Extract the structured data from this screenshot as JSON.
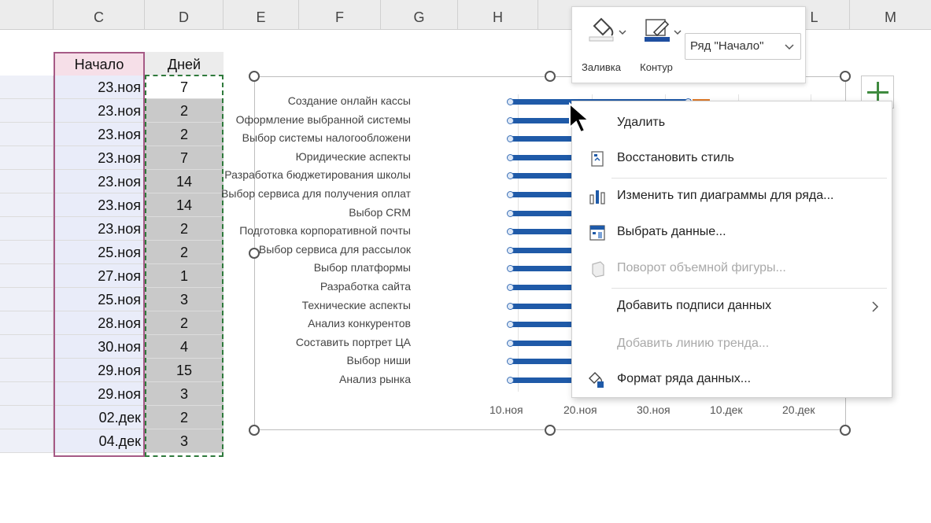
{
  "columns": [
    "C",
    "D",
    "E",
    "F",
    "G",
    "H",
    "L",
    "M"
  ],
  "table": {
    "header_start": "Начало",
    "header_days": "Дней",
    "start": [
      "23.ноя",
      "23.ноя",
      "23.ноя",
      "23.ноя",
      "23.ноя",
      "23.ноя",
      "23.ноя",
      "25.ноя",
      "27.ноя",
      "25.ноя",
      "28.ноя",
      "30.ноя",
      "29.ноя",
      "29.ноя",
      "02.дек",
      "04.дек"
    ],
    "days": [
      "7",
      "2",
      "2",
      "7",
      "14",
      "14",
      "2",
      "2",
      "1",
      "3",
      "2",
      "4",
      "15",
      "3",
      "2",
      "3"
    ]
  },
  "chart_data": {
    "type": "bar",
    "orientation": "horizontal",
    "categories": [
      "Создание онлайн кассы",
      "Оформление выбранной системы",
      "Выбор системы налогообложени",
      "Юридические аспекты",
      "Разработка бюджетирования школы",
      "Выбор сервиса для получения оплат",
      "Выбор CRM",
      "Подготовка корпоративной почты",
      "Выбор сервиса для рассылок",
      "Выбор платформы",
      "Разработка сайта",
      "Технические аспекты",
      "Анализ конкурентов",
      "Составить портрет ЦА",
      "Выбор ниши",
      "Анализ рынка"
    ],
    "x_ticks": [
      "10.ноя",
      "20.ноя",
      "30.ноя",
      "10.дек",
      "20.дек"
    ],
    "selected_series": "Начало",
    "series_color": "#1f5aa8"
  },
  "minibar": {
    "fill_label": "Заливка",
    "outline_label": "Контур",
    "series_selector": "Ряд \"Начало\""
  },
  "context_menu": {
    "items": [
      {
        "label": "Удалить",
        "disabled": false
      },
      {
        "label": "Восстановить стиль",
        "disabled": false
      },
      {
        "label": "Изменить тип диаграммы для ряда...",
        "disabled": false
      },
      {
        "label": "Выбрать данные...",
        "disabled": false
      },
      {
        "label": "Поворот объемной фигуры...",
        "disabled": true
      },
      {
        "label": "Добавить подписи данных",
        "disabled": false
      },
      {
        "label": "Добавить линию тренда...",
        "disabled": true
      },
      {
        "label": "Формат ряда данных...",
        "disabled": false
      }
    ]
  }
}
